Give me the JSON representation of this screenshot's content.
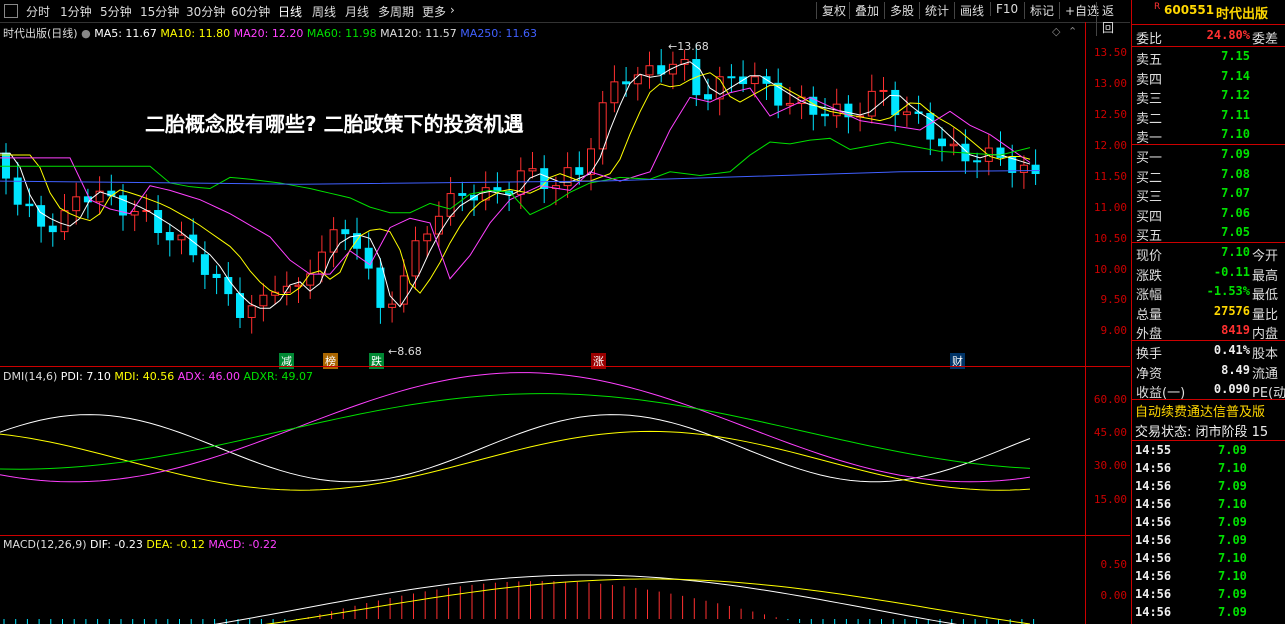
{
  "toolbar": {
    "periods": [
      "分时",
      "1分钟",
      "5分钟",
      "15分钟",
      "30分钟",
      "60分钟",
      "日线",
      "周线",
      "月线",
      "多周期",
      "更多"
    ],
    "active": "日线",
    "right_buttons": [
      "复权",
      "叠加",
      "多股",
      "统计",
      "画线",
      "F10",
      "标记",
      "+自选",
      "返回"
    ]
  },
  "header": {
    "title": "时代出版(日线)",
    "ma5": "MA5: 11.67",
    "ma10": "MA10: 11.80",
    "ma20": "MA20: 12.20",
    "ma60": "MA60: 11.98",
    "ma120": "MA120: 11.57",
    "ma250": "MA250: 11.63"
  },
  "overlay_title": "二胎概念股有哪些? 二胎政策下的投资机遇",
  "price_axis": [
    "13.50",
    "13.00",
    "12.50",
    "12.00",
    "11.50",
    "11.00",
    "10.50",
    "10.00",
    "9.50",
    "9.00"
  ],
  "annotations": {
    "high": "13.68",
    "low": "8.68"
  },
  "tags": [
    "减",
    "榜",
    "跌",
    "涨",
    "财"
  ],
  "dmi": {
    "title": "DMI(14,6)",
    "pdi": "PDI: 7.10",
    "mdi": "MDI: 40.56",
    "adx": "ADX: 46.00",
    "adxr": "ADXR: 49.07",
    "axis": [
      "60.00",
      "45.00",
      "30.00",
      "15.00"
    ]
  },
  "macd": {
    "title": "MACD(12,26,9)",
    "dif": "DIF: -0.23",
    "dea": "DEA: -0.12",
    "macd": "MACD: -0.22",
    "axis": [
      "0.50",
      "0.00"
    ]
  },
  "quote": {
    "code": "600551",
    "name": "时代出版",
    "weibi_label": "委比",
    "weibi": "24.80%",
    "weicha_label": "委差",
    "asks": [
      {
        "label": "卖五",
        "price": "7.15"
      },
      {
        "label": "卖四",
        "price": "7.14"
      },
      {
        "label": "卖三",
        "price": "7.12"
      },
      {
        "label": "卖二",
        "price": "7.11"
      },
      {
        "label": "卖一",
        "price": "7.10"
      }
    ],
    "bids": [
      {
        "label": "买一",
        "price": "7.09"
      },
      {
        "label": "买二",
        "price": "7.08"
      },
      {
        "label": "买三",
        "price": "7.07"
      },
      {
        "label": "买四",
        "price": "7.06"
      },
      {
        "label": "买五",
        "price": "7.05"
      }
    ],
    "stats": [
      {
        "label": "现价",
        "value": "7.10",
        "label2": "今开",
        "color": "#00e000"
      },
      {
        "label": "涨跌",
        "value": "-0.11",
        "label2": "最高",
        "color": "#00e000"
      },
      {
        "label": "涨幅",
        "value": "-1.53%",
        "label2": "最低",
        "color": "#00e000"
      },
      {
        "label": "总量",
        "value": "27576",
        "label2": "量比",
        "color": "#ffd700"
      },
      {
        "label": "外盘",
        "value": "8419",
        "label2": "内盘",
        "color": "#ff3030"
      }
    ],
    "stats2": [
      {
        "label": "换手",
        "value": "0.41%",
        "label2": "股本"
      },
      {
        "label": "净资",
        "value": "8.49",
        "label2": "流通"
      },
      {
        "label": "收益(一)",
        "value": "0.090",
        "label2": "PE(动"
      }
    ],
    "notice": "自动续费通达信普及版",
    "status": "交易状态: 闭市阶段 15",
    "ticks": [
      {
        "t": "14:55",
        "p": "7.09"
      },
      {
        "t": "14:56",
        "p": "7.10"
      },
      {
        "t": "14:56",
        "p": "7.09"
      },
      {
        "t": "14:56",
        "p": "7.10"
      },
      {
        "t": "14:56",
        "p": "7.09"
      },
      {
        "t": "14:56",
        "p": "7.09"
      },
      {
        "t": "14:56",
        "p": "7.10"
      },
      {
        "t": "14:56",
        "p": "7.10"
      },
      {
        "t": "14:56",
        "p": "7.09"
      },
      {
        "t": "14:56",
        "p": "7.09"
      }
    ]
  },
  "colors": {
    "up": "#ff3030",
    "down": "#00e5ff",
    "ma5": "#ffffff",
    "ma10": "#ffff00",
    "ma20": "#ff40ff",
    "ma60": "#00e000",
    "ma120": "#4060ff"
  }
}
